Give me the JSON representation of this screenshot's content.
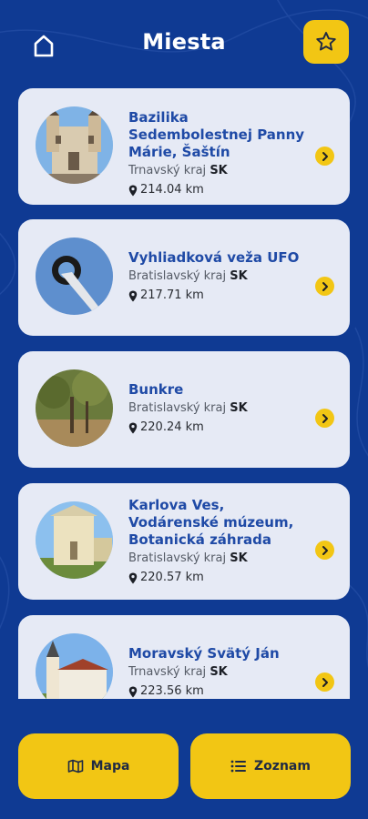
{
  "header": {
    "title": "Miesta",
    "home_icon": "home-icon",
    "favorite_icon": "star-icon"
  },
  "places": [
    {
      "name": "Bazilika Sedembolestnej Panny Márie, Šaštín",
      "region": "Trnavský kraj",
      "country": "SK",
      "distance": "214.04 km"
    },
    {
      "name": "Vyhliadková veža UFO",
      "region": "Bratislavský kraj",
      "country": "SK",
      "distance": "217.71 km"
    },
    {
      "name": "Bunkre",
      "region": "Bratislavský kraj",
      "country": "SK",
      "distance": "220.24 km"
    },
    {
      "name": "Karlova Ves, Vodárenské múzeum, Botanická záhrada",
      "region": "Bratislavský kraj",
      "country": "SK",
      "distance": "220.57 km"
    },
    {
      "name": "Moravský Svätý Ján",
      "region": "Trnavský kraj",
      "country": "SK",
      "distance": "223.56 km"
    }
  ],
  "bottom_nav": {
    "map_label": "Mapa",
    "list_label": "Zoznam"
  },
  "colors": {
    "background": "#0f3a93",
    "accent": "#f2c614",
    "card": "#e6eaf5",
    "title_text": "#1f4aa6"
  }
}
